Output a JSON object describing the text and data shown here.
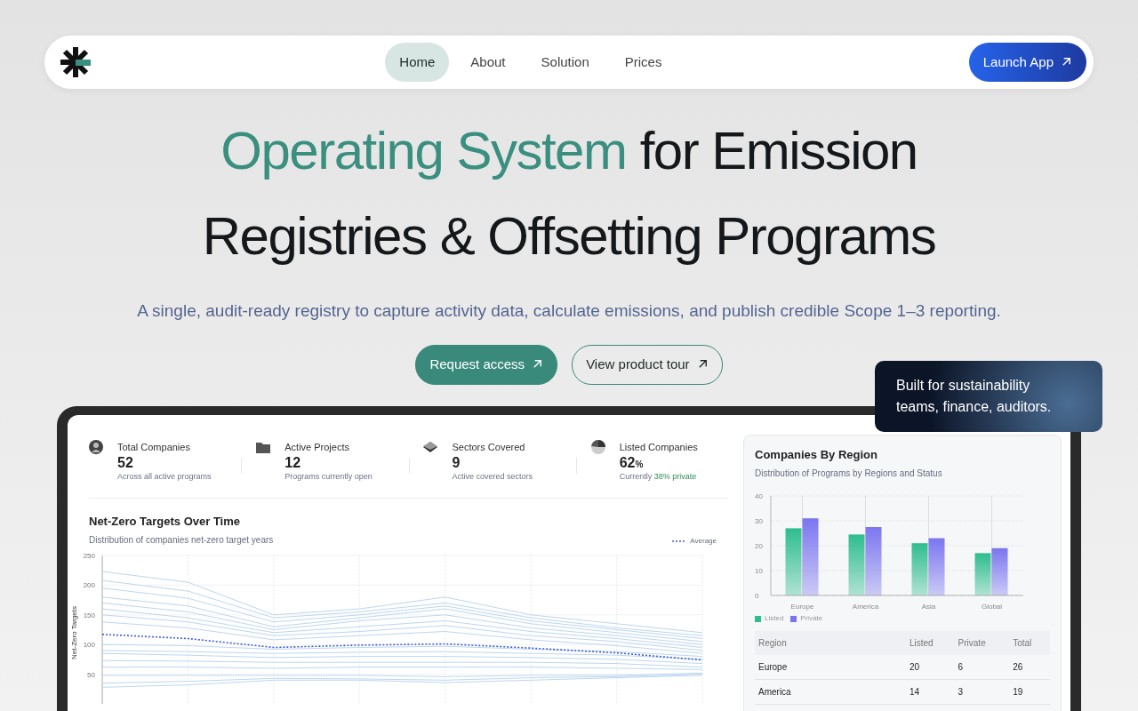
{
  "nav": {
    "items": [
      {
        "label": "Home",
        "selected": true
      },
      {
        "label": "About",
        "selected": false
      },
      {
        "label": "Solution",
        "selected": false
      },
      {
        "label": "Prices",
        "selected": false
      }
    ],
    "cta": "Launch App"
  },
  "hero": {
    "title_accent": "Operating System",
    "title_rest": "for Emission",
    "title_line2": "Registries & Offsetting Programs",
    "subtitle": "A single, audit-ready registry to capture activity data, calculate emissions, and publish credible Scope 1–3 reporting.",
    "buttons": [
      {
        "label": "Request access",
        "kind": "primary"
      },
      {
        "label": "View product tour",
        "kind": "outline"
      }
    ]
  },
  "callout": "Built for sustainability teams, finance, auditors.",
  "stats": [
    {
      "kind": "person",
      "label": "Total Companies",
      "value": "52",
      "note": "Across all active programs"
    },
    {
      "kind": "folder",
      "label": "Active Projects",
      "value": "12",
      "note": "Programs currently open"
    },
    {
      "kind": "layers",
      "label": "Sectors Covered",
      "value": "9",
      "note": "Active covered sectors"
    },
    {
      "kind": "pie",
      "label": "Listed Companies",
      "value": "62",
      "unit": "%",
      "note": "Currently",
      "highlight": "38% private"
    }
  ],
  "line_panel": {
    "title": "Net-Zero Targets Over Time",
    "subtitle": "Distribution of companies net-zero target years",
    "chart_data": {
      "type": "line",
      "ylabel": "Net-Zero Targets",
      "ylim": [
        0,
        250
      ],
      "yticks": [
        50,
        100,
        150,
        200,
        250
      ],
      "grid": true,
      "series": [
        {
          "name": "Average",
          "color": "#3b5bdb",
          "line_style": "dashed",
          "values": [
            117,
            110,
            95,
            99,
            101,
            94,
            86,
            74
          ]
        },
        {
          "color": "#bcd6f0",
          "values": [
            223,
            205,
            150,
            160,
            180,
            150,
            135,
            120
          ]
        },
        {
          "color": "#bcd6f0",
          "values": [
            208,
            190,
            145,
            155,
            170,
            145,
            128,
            115
          ]
        },
        {
          "color": "#bcd6f0",
          "values": [
            195,
            178,
            138,
            150,
            165,
            140,
            125,
            110
          ]
        },
        {
          "color": "#bcd6f0",
          "values": [
            180,
            165,
            130,
            145,
            160,
            135,
            120,
            105
          ]
        },
        {
          "color": "#bcd6f0",
          "values": [
            170,
            155,
            125,
            140,
            150,
            128,
            115,
            100
          ]
        },
        {
          "color": "#bcd6f0",
          "values": [
            160,
            145,
            120,
            130,
            140,
            122,
            110,
            95
          ]
        },
        {
          "color": "#bcd6f0",
          "values": [
            150,
            138,
            115,
            122,
            132,
            115,
            105,
            90
          ]
        },
        {
          "color": "#bcd6f0",
          "values": [
            138,
            128,
            108,
            115,
            122,
            108,
            98,
            85
          ]
        },
        {
          "color": "#bcd6f0",
          "values": [
            100,
            98,
            92,
            95,
            97,
            92,
            88,
            80
          ]
        },
        {
          "color": "#bcd6f0",
          "values": [
            90,
            88,
            85,
            87,
            88,
            85,
            82,
            75
          ]
        },
        {
          "color": "#bcd6f0",
          "values": [
            85,
            82,
            78,
            80,
            80,
            78,
            75,
            68
          ]
        },
        {
          "color": "#bcd6f0",
          "values": [
            73,
            72,
            70,
            70,
            70,
            70,
            68,
            62
          ]
        },
        {
          "color": "#bcd6f0",
          "values": [
            62,
            62,
            60,
            62,
            62,
            62,
            60,
            58
          ]
        },
        {
          "color": "#bcd6f0",
          "values": [
            48,
            48,
            48,
            48,
            46,
            48,
            48,
            52
          ]
        },
        {
          "color": "#bcd6f0",
          "values": [
            35,
            38,
            43,
            42,
            40,
            44,
            46,
            50
          ]
        },
        {
          "color": "#bcd6f0",
          "values": [
            28,
            32,
            40,
            40,
            36,
            40,
            44,
            48
          ]
        }
      ]
    }
  },
  "region_panel": {
    "title": "Companies By Region",
    "subtitle": "Distribution of Programs by Regions and Status",
    "chart_data": {
      "type": "bar",
      "categories": [
        "Europe",
        "America",
        "Asia",
        "Global"
      ],
      "ylim": [
        0,
        40
      ],
      "yticks": [
        0,
        10,
        20,
        30,
        40
      ],
      "grid": true,
      "series": [
        {
          "name": "Listed",
          "color": "#2ebd8f",
          "values": [
            27,
            24.5,
            21,
            17
          ]
        },
        {
          "name": "Private",
          "color": "#7b76f0",
          "values": [
            31,
            27.5,
            23,
            19
          ]
        }
      ]
    },
    "table": {
      "columns": [
        "Region",
        "Listed",
        "Private",
        "Total"
      ],
      "rows": [
        [
          "Europe",
          "20",
          "6",
          "26"
        ],
        [
          "America",
          "14",
          "3",
          "19"
        ]
      ]
    }
  }
}
